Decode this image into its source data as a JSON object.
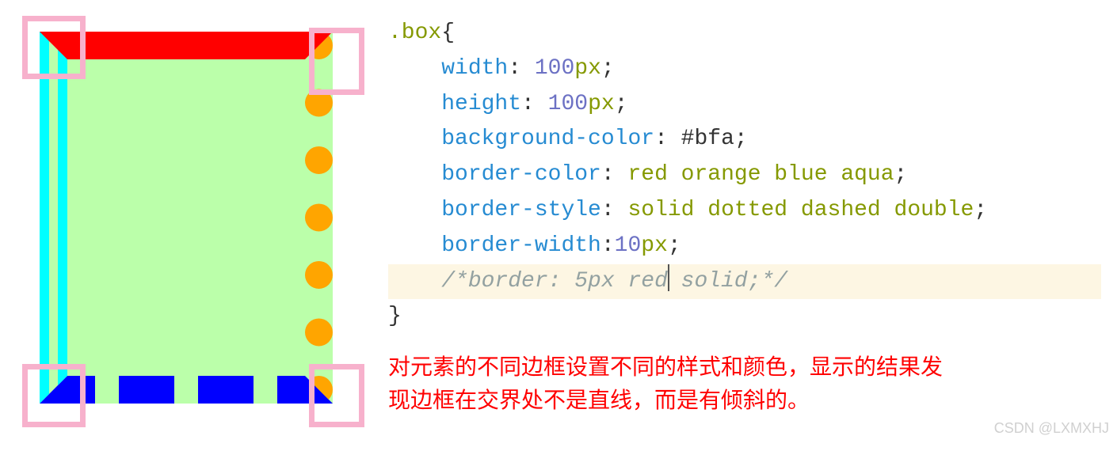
{
  "code": {
    "selector": ".box",
    "brace_open": "{",
    "brace_close": "}",
    "lines": {
      "width": {
        "prop": "width",
        "colon": ": ",
        "num": "100",
        "unit": "px",
        "sc": ";"
      },
      "height": {
        "prop": "height",
        "colon": ": ",
        "num": "100",
        "unit": "px",
        "sc": ";"
      },
      "bg": {
        "prop": "background-color",
        "colon": ": ",
        "val": "#bfa",
        "sc": ";"
      },
      "bcolor": {
        "prop": "border-color",
        "colon": ": ",
        "val": "red orange blue aqua",
        "sc": ";"
      },
      "bstyle": {
        "prop": "border-style",
        "colon": ": ",
        "val": "solid dotted dashed double",
        "sc": ";"
      },
      "bwidth": {
        "prop": "border-width",
        "colon": ":",
        "num": "10",
        "unit": "px",
        "sc": ";"
      },
      "comment_pre": "/*border: 5px red",
      "comment_post": " solid;*/"
    }
  },
  "note": {
    "line1": "对元素的不同边框设置不同的样式和颜色，显示的结果发",
    "line2": "现边框在交界处不是直线，而是有倾斜的。"
  },
  "watermark": "CSDN @LXMXHJ"
}
